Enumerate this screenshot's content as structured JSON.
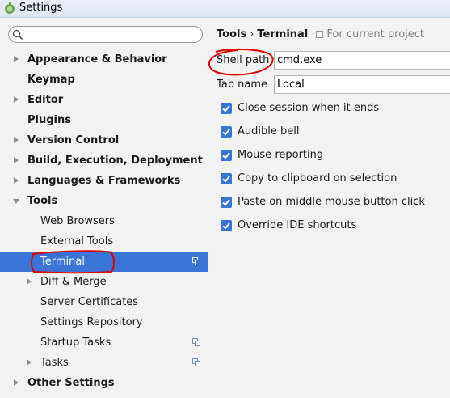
{
  "window": {
    "title": "Settings"
  },
  "search": {
    "placeholder": ""
  },
  "sidebar": {
    "items": [
      {
        "label": "Appearance & Behavior"
      },
      {
        "label": "Keymap"
      },
      {
        "label": "Editor"
      },
      {
        "label": "Plugins"
      },
      {
        "label": "Version Control"
      },
      {
        "label": "Build, Execution, Deployment"
      },
      {
        "label": "Languages & Frameworks"
      },
      {
        "label": "Tools"
      },
      {
        "label": "Web Browsers"
      },
      {
        "label": "External Tools"
      },
      {
        "label": "Terminal"
      },
      {
        "label": "Diff & Merge"
      },
      {
        "label": "Server Certificates"
      },
      {
        "label": "Settings Repository"
      },
      {
        "label": "Startup Tasks"
      },
      {
        "label": "Tasks"
      },
      {
        "label": "Other Settings"
      }
    ]
  },
  "breadcrumb": {
    "parent": "Tools",
    "separator": "›",
    "current": "Terminal",
    "scope": "For current project"
  },
  "form": {
    "shell_path_label": "Shell path",
    "shell_path_value": "cmd.exe",
    "tab_name_label": "Tab name",
    "tab_name_value": "Local"
  },
  "options": [
    {
      "label": "Close session when it ends",
      "checked": true
    },
    {
      "label": "Audible bell",
      "checked": true
    },
    {
      "label": "Mouse reporting",
      "checked": true
    },
    {
      "label": "Copy to clipboard on selection",
      "checked": true
    },
    {
      "label": "Paste on middle mouse button click",
      "checked": true
    },
    {
      "label": "Override IDE shortcuts",
      "checked": true
    }
  ],
  "colors": {
    "selection": "#3875d7",
    "annotation": "#e00000"
  }
}
